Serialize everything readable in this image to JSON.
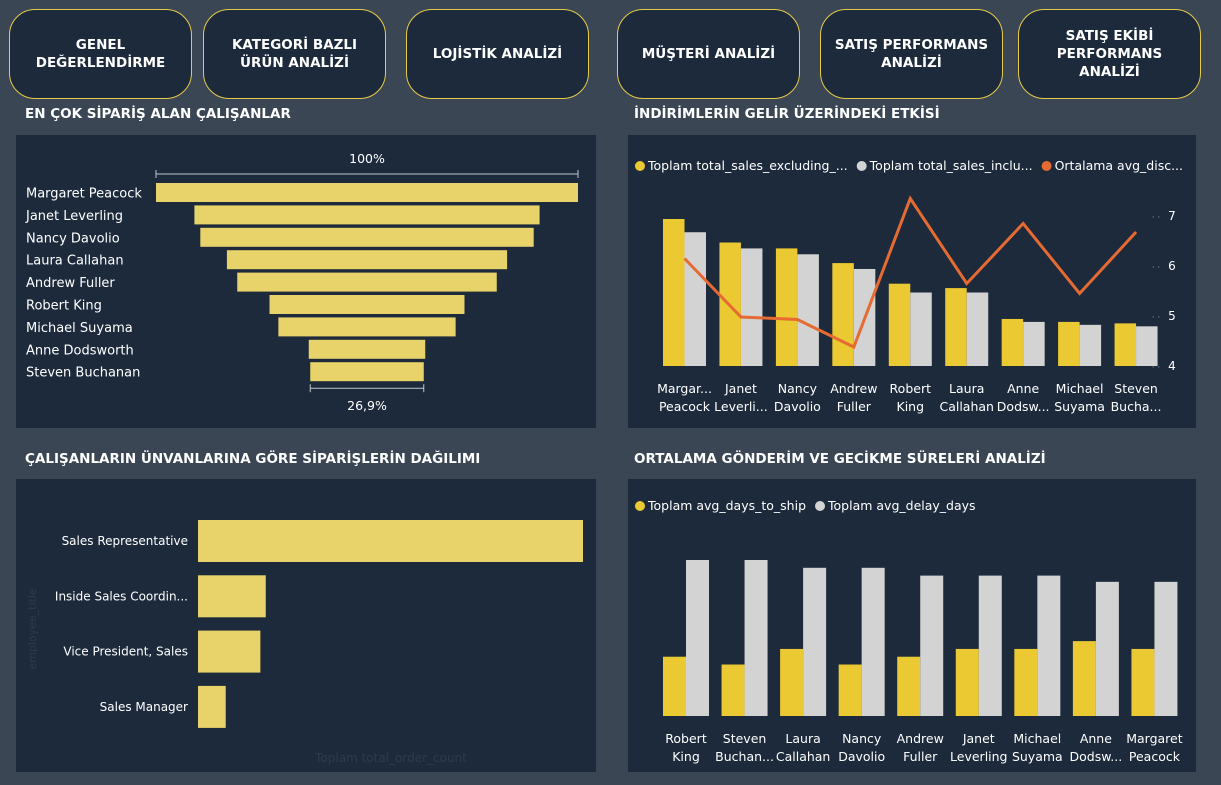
{
  "nav": [
    {
      "label": "GENEL DEĞERLENDİRME"
    },
    {
      "label": "KATEGORİ BAZLI ÜRÜN ANALİZİ"
    },
    {
      "label": "LOJİSTİK ANALİZİ"
    },
    {
      "label": "MÜŞTERİ ANALİZİ"
    },
    {
      "label": "SATIŞ PERFORMANS ANALİZİ"
    },
    {
      "label": "SATIŞ EKİBİ PERFORMANS ANALİZİ"
    }
  ],
  "titles": {
    "funnel": "EN ÇOK SİPARİŞ ALAN ÇALIŞANLAR",
    "discount": "İNDİRİMLERİN GELİR ÜZERİNDEKİ ETKİSİ",
    "titles_chart": "ÇALIŞANLARIN ÜNVANLARINA GÖRE SİPARİŞLERİN DAĞILIMI",
    "shipping": "ORTALAMA GÖNDERİM VE GECİKME SÜRELERİ ANALİZİ"
  },
  "colors": {
    "background": "#3b4654",
    "panel": "#1c2a3b",
    "accent": "#e6cb4a",
    "yellow": "#ebc932",
    "gray": "#d3d3d3",
    "orange": "#e56b32",
    "funnel": "#e8d26a"
  },
  "chart_data": [
    {
      "type": "funnel",
      "title": "EN ÇOK SİPARİŞ ALAN ÇALIŞANLAR",
      "categories": [
        "Margaret Peacock",
        "Janet Leverling",
        "Nancy Davolio",
        "Laura Callahan",
        "Andrew Fuller",
        "Robert King",
        "Michael Suyama",
        "Anne Dodsworth",
        "Steven Buchanan"
      ],
      "values": [
        100,
        81.8,
        79.0,
        66.4,
        61.5,
        46.2,
        42.0,
        27.6,
        26.9
      ],
      "top_label": "100%",
      "bottom_label": "26,9%"
    },
    {
      "type": "bar",
      "title": "İNDİRİMLERİN GELİR ÜZERİNDEKİ ETKİSİ",
      "categories": [
        "Margaret Peacock",
        "Janet Leverling",
        "Nancy Davolio",
        "Andrew Fuller",
        "Robert King",
        "Laura Callahan",
        "Anne Dodsworth",
        "Michael Suyama",
        "Steven Buchanan"
      ],
      "category_labels": [
        [
          "Margar...",
          "Peacock"
        ],
        [
          "Janet",
          "Leverli..."
        ],
        [
          "Nancy",
          "Davolio"
        ],
        [
          "Andrew",
          "Fuller"
        ],
        [
          "Robert",
          "King"
        ],
        [
          "Laura",
          "Callahan"
        ],
        [
          "Anne",
          "Dodsw..."
        ],
        [
          "Michael",
          "Suyama"
        ],
        [
          "Steven",
          "Bucha..."
        ]
      ],
      "legend": [
        "Toplam total_sales_excluding_...",
        "Toplam total_sales_inclu...",
        "Ortalama avg_disc..."
      ],
      "series": [
        {
          "name": "Toplam total_sales_excluding_...",
          "values": [
            1.0,
            0.84,
            0.8,
            0.7,
            0.56,
            0.53,
            0.32,
            0.3,
            0.29
          ]
        },
        {
          "name": "Toplam total_sales_inclu...",
          "values": [
            0.91,
            0.8,
            0.76,
            0.66,
            0.5,
            0.5,
            0.3,
            0.28,
            0.27
          ]
        },
        {
          "name": "Ortalama avg_disc...",
          "values": [
            6.15,
            4.98,
            4.93,
            4.38,
            7.35,
            5.65,
            6.85,
            5.45,
            6.68
          ]
        }
      ],
      "y2_ticks": [
        "4",
        "5",
        "6",
        "7"
      ],
      "y2lim": [
        4,
        7
      ]
    },
    {
      "type": "bar",
      "title": "ÇALIŞANLARIN ÜNVANLARINA GÖRE SİPARİŞLERİN DAĞILIMI",
      "categories": [
        "Sales Representative",
        "Inside Sales Coordin...",
        "Vice President, Sales",
        "Sales Manager"
      ],
      "values": [
        100,
        17.6,
        16.2,
        7.2
      ],
      "xlabel": "Toplam total_order_count",
      "ylabel": "employee_title"
    },
    {
      "type": "bar",
      "title": "ORTALAMA GÖNDERİM VE GECİKME SÜRELERİ ANALİZİ",
      "categories": [
        "Robert King",
        "Steven Buchanan",
        "Laura Callahan",
        "Nancy Davolio",
        "Andrew Fuller",
        "Janet Leverling",
        "Michael Suyama",
        "Anne Dodsworth",
        "Margaret Peacock"
      ],
      "category_labels": [
        [
          "Robert",
          "King"
        ],
        [
          "Steven",
          "Buchan..."
        ],
        [
          "Laura",
          "Callahan"
        ],
        [
          "Nancy",
          "Davolio"
        ],
        [
          "Andrew",
          "Fuller"
        ],
        [
          "Janet",
          "Leverling"
        ],
        [
          "Michael",
          "Suyama"
        ],
        [
          "Anne",
          "Dodsw..."
        ],
        [
          "Margaret",
          "Peacock"
        ]
      ],
      "legend": [
        "Toplam avg_days_to_ship",
        "Toplam avg_delay_days"
      ],
      "series": [
        {
          "name": "Toplam avg_days_to_ship",
          "values": [
            0.38,
            0.33,
            0.43,
            0.33,
            0.38,
            0.43,
            0.43,
            0.48,
            0.43
          ]
        },
        {
          "name": "Toplam avg_delay_days",
          "values": [
            1.0,
            1.0,
            0.95,
            0.95,
            0.9,
            0.9,
            0.9,
            0.86,
            0.86
          ]
        }
      ]
    }
  ]
}
